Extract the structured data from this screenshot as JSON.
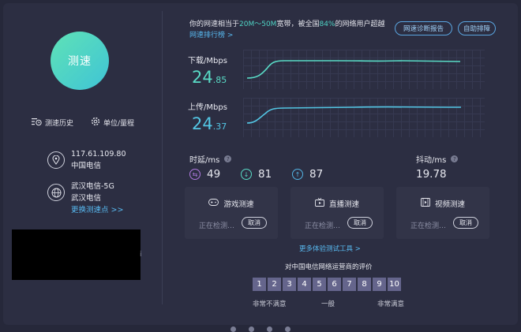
{
  "left": {
    "start_button": "测速",
    "history": "测速历史",
    "unit": "单位/量程",
    "ip": "117.61.109.80",
    "isp": "中国电信",
    "server_name": "武汉电信-5G",
    "server_isp": "武汉电信",
    "change_server": "更换测速点 >>",
    "stray_char": "i"
  },
  "summary": {
    "prefix": "你的网速相当于",
    "bandwidth": "20M～50M",
    "middle": "宽带，被全国",
    "percent": "84%",
    "suffix": "的网络用户超越",
    "ranking_link": "网速排行榜 >"
  },
  "actions": {
    "diagnose": "网速诊断报告",
    "auto_fix": "自助排障"
  },
  "download": {
    "label": "下载/Mbps",
    "value_int": "24",
    "value_dec": ".85",
    "value": 24.85
  },
  "upload": {
    "label": "上传/Mbps",
    "value_int": "24",
    "value_dec": ".37",
    "value": 24.37
  },
  "latency": {
    "label": "时延/ms",
    "bidir": "49",
    "down": "81",
    "up": "87"
  },
  "jitter": {
    "label": "抖动/ms",
    "value": "19.78"
  },
  "cards": [
    {
      "title": "游戏测速",
      "status": "正在检测…",
      "cancel": "取消"
    },
    {
      "title": "直播测速",
      "status": "正在检测…",
      "cancel": "取消"
    },
    {
      "title": "视频测速",
      "status": "正在检测…",
      "cancel": "取消"
    }
  ],
  "more_tools": "更多体验测试工具 >",
  "rating": {
    "title": "对中国电信网络运营商的评价",
    "options": [
      "1",
      "2",
      "3",
      "4",
      "5",
      "6",
      "7",
      "8",
      "9",
      "10"
    ],
    "low": "非常不满意",
    "mid": "一般",
    "high": "非常满意"
  },
  "colors": {
    "accent_green": "#59dbc6",
    "accent_blue": "#53c6e4",
    "link": "#58b9f0",
    "rating_bg": "#65658c"
  }
}
